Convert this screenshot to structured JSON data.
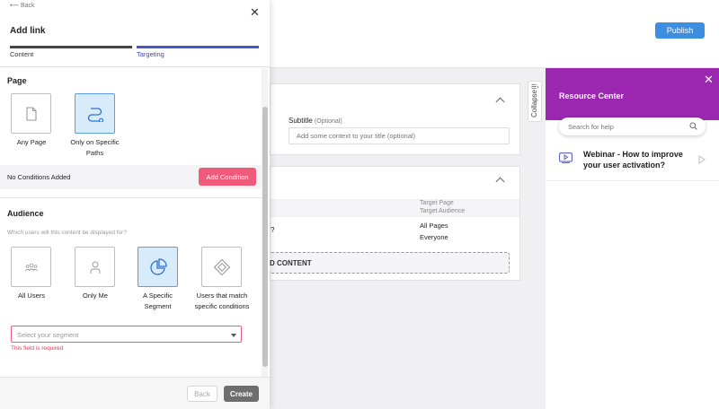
{
  "app": {
    "publish_label": "Publish"
  },
  "editor": {
    "subtitle_label": "Subtitle",
    "subtitle_optional": "(Optional)",
    "subtitle_placeholder": "Add some context to your title (optional)",
    "table_head_1": "Target Page",
    "table_head_2": "Target Audience",
    "row_question": "?",
    "row_page": "All Pages",
    "row_audience": "Everyone",
    "add_content_label": "D CONTENT",
    "collapse_label": "Collapse"
  },
  "resource_center": {
    "title": "Resource Center",
    "search_placeholder": "Search for help",
    "items": [
      {
        "title": "Webinar - How to improve your user activation?",
        "icon": "video-icon"
      }
    ]
  },
  "modal": {
    "back_label": "Back",
    "title": "Add link",
    "steps": [
      {
        "label": "Content",
        "state": "done"
      },
      {
        "label": "Targeting",
        "state": "active"
      }
    ],
    "page_section_title": "Page",
    "page_options": [
      {
        "label": "Any Page",
        "icon": "document-icon",
        "selected": false
      },
      {
        "label": "Only on Specific Paths",
        "icon": "path-icon",
        "selected": true
      }
    ],
    "no_conditions": "No Conditions Added",
    "add_condition_label": "Add Condition",
    "audience_section_title": "Audience",
    "audience_question": "Which users will this content be displayed for?",
    "audience_options": [
      {
        "label": "All Users",
        "icon": "users-icon",
        "selected": false
      },
      {
        "label": "Only Me",
        "icon": "user-icon",
        "selected": false
      },
      {
        "label": "A Specific Segment",
        "icon": "pie-chart-icon",
        "selected": true
      },
      {
        "label": "Users that match specific conditions",
        "icon": "diamond-icon",
        "selected": false
      }
    ],
    "segment_placeholder": "Select your segment",
    "segment_error": "This field is required",
    "back_button_label": "Back",
    "create_button_label": "Create"
  },
  "colors": {
    "primary": "#3b8ee0",
    "accent_pink": "#ef5a7a",
    "resource_center_purple": "#9b27b0",
    "step_active": "#4a56c6",
    "tile_selected": "#d8ebfa"
  }
}
